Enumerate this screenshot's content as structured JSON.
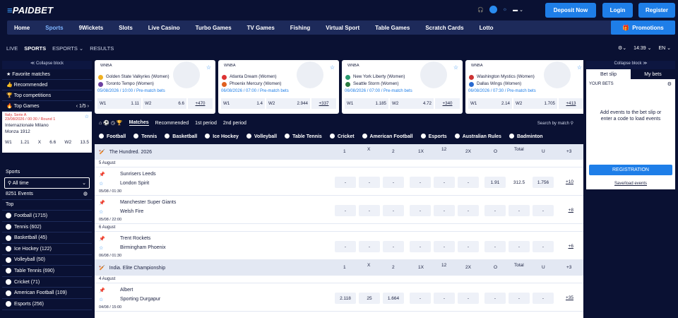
{
  "header": {
    "logo_a": "≡",
    "logo_b": "PAIDBET",
    "deposit": "Deposit Now",
    "login": "Login",
    "register": "Register",
    "lang": "EN"
  },
  "nav": [
    "Home",
    "Sports",
    "9Wickets",
    "Slots",
    "Live Casino",
    "Turbo Games",
    "TV Games",
    "Fishing",
    "Virtual Sport",
    "Table Games",
    "Scratch Cards",
    "Lotto"
  ],
  "promotions": "Promotions",
  "subnav": [
    "LIVE",
    "SPORTS",
    "ESPORTS ⌄",
    "RESULTS"
  ],
  "time": "14:39 ⌄",
  "langsel": "EN ⌄",
  "left": {
    "collapse": "≪ Collapse block",
    "fav": "Favorite matches",
    "rec": "Recommended",
    "top": "Top competitions",
    "topgames": "Top Games",
    "pager": "‹ 1/5 ›",
    "tg_league": "Italy. Serie A",
    "tg_date": "23/08/2026 / 00:30 / Round 1",
    "tg_t1": "Internazionale Milano",
    "tg_t2": "Monza 1912",
    "tg_odds": [
      "W1",
      "1.21",
      "X",
      "6.6",
      "W2",
      "13.5"
    ],
    "sports": "Sports",
    "alltime": "All time",
    "events": "8251 Events",
    "topl": "Top",
    "list": [
      "Football (1715)",
      "Tennis (602)",
      "Basketball (45)",
      "Ice Hockey (122)",
      "Volleyball (50)",
      "Table Tennis (690)",
      "Cricket (71)",
      "American Football (109)",
      "Esports (256)"
    ]
  },
  "cards": [
    {
      "league": "WNBA",
      "t1": "Golden State Valkyries (Women)",
      "t2": "Toronto Tempo (Women)",
      "date": "05/08/2026 / 10:00 / Pre-match bets",
      "w1": "1.11",
      "w2": "6.6",
      "more": "+470"
    },
    {
      "league": "WNBA",
      "t1": "Atlanta Dream (Women)",
      "t2": "Phoenix Mercury (Women)",
      "date": "06/08/2026 / 07:00 / Pre-match bets",
      "w1": "1.4",
      "w2": "2.944",
      "more": "+337"
    },
    {
      "league": "WNBA",
      "t1": "New York Liberty (Women)",
      "t2": "Seattle Storm (Women)",
      "date": "06/08/2026 / 07:00 / Pre-match bets",
      "w1": "1.185",
      "w2": "4.72",
      "more": "+340"
    },
    {
      "league": "WNBA",
      "t1": "Washington Mystics (Women)",
      "t2": "Dallas Wings (Women)",
      "date": "06/08/2026 / 07:30 / Pre-match bets",
      "w1": "2.14",
      "w2": "1.705",
      "more": "+413"
    }
  ],
  "main": {
    "tabs": [
      "Matches",
      "Recommended",
      "1st period",
      "2nd period"
    ],
    "search": "Search by match",
    "sports": [
      "Football",
      "Tennis",
      "Basketball",
      "Ice Hockey",
      "Volleyball",
      "Table Tennis",
      "Cricket",
      "American Football",
      "Esports",
      "Australian Rules",
      "Badminton"
    ],
    "cols": [
      "1",
      "X",
      "2",
      "1X",
      "12",
      "2X",
      "O",
      "Total",
      "U",
      "+3"
    ],
    "league1": "The Hundred. 2026",
    "league2": "India. Elite Championship",
    "day1": "5 August",
    "day2": "6 August",
    "day3": "4 August",
    "m1": {
      "t1": "Sunrisers Leeds",
      "t2": "London Spirit",
      "tm": "05/08 / 01:30",
      "o": "1.91",
      "t": "312.5",
      "u": "1.756",
      "more": "+10"
    },
    "m2": {
      "t1": "Manchester Super Giants",
      "t2": "Welsh Fire",
      "tm": "05/08 / 22:00",
      "more": "+8"
    },
    "m3": {
      "t1": "Trent Rockets",
      "t2": "Birmingham Phoenix",
      "tm": "06/08 / 01:30",
      "more": "+6"
    },
    "m4": {
      "t1": "Albert",
      "t2": "Sporting Durgapur",
      "tm": "04/08 / 15:00",
      "w1": "2.118",
      "x": "25",
      "w2": "1.664",
      "more": "+35"
    },
    "dash": "-"
  },
  "right": {
    "collapse": "Collapse block ≫",
    "betslip": "Bet slip",
    "mybets": "My bets",
    "yourbets": "YOUR BETS",
    "msg": "Add events to the bet slip or enter a code to load events",
    "reg": "REGISTRATION",
    "load": "Save/load events"
  }
}
